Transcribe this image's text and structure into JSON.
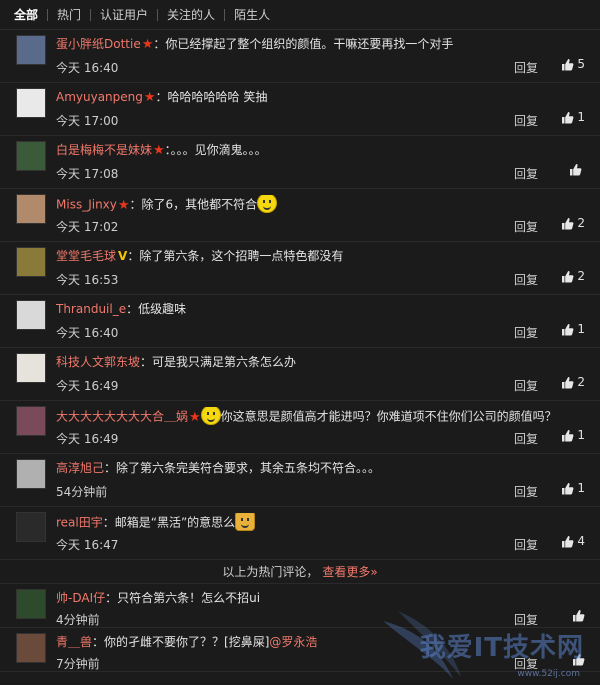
{
  "tabs": [
    "全部",
    "热门",
    "认证用户",
    "关注的人",
    "陌生人"
  ],
  "reply_label": "回复",
  "comments": [
    {
      "user": "蛋小胖纸Dottie",
      "badge": "star",
      "text": "：你已经撑起了整个组织的颜值。干嘛还要再找一个对手",
      "time": "今天 16:40",
      "likes": "5",
      "avatar": "#5a6a8a"
    },
    {
      "user": "Amyuyanpeng",
      "badge": "star",
      "text": "：哈哈哈哈哈哈 笑抽",
      "time": "今天 17:00",
      "likes": "1",
      "avatar": "#e9e9e9"
    },
    {
      "user": "白是梅梅不是妹妹",
      "badge": "star",
      "text": "：。。。见你滴鬼。。。",
      "time": "今天 17:08",
      "likes": "",
      "avatar": "#3a5a3a"
    },
    {
      "user": "Miss_Jinxy",
      "badge": "star",
      "text": "：除了6，其他都不符合",
      "emoji": "smile",
      "time": "今天 17:02",
      "likes": "2",
      "avatar": "#b08a6a"
    },
    {
      "user": "堂堂毛毛球",
      "badge": "v",
      "text": "：除了第六条，这个招聘一点特色都没有",
      "time": "今天 16:53",
      "likes": "2",
      "avatar": "#8a7a3a"
    },
    {
      "user": "Thranduil_e",
      "badge": "",
      "text": "：低级趣味",
      "time": "今天 16:40",
      "likes": "1",
      "avatar": "#d9d9d9"
    },
    {
      "user": "科技人文郭东坡",
      "badge": "",
      "text": "：可是我只满足第六条怎么办",
      "time": "今天 16:49",
      "likes": "2",
      "avatar": "#e6e2dc"
    },
    {
      "user": "大大大大大大大大合＿娲",
      "badge": "star",
      "text": "你这意思是颜值高才能进吗？你难道项不住你们公司的颜值吗？",
      "emoji": "laugh",
      "time": "今天 16:49",
      "likes": "1",
      "avatar": "#7a4a5a"
    },
    {
      "user": "高淳旭己",
      "badge": "",
      "text": "：除了第六条完美符合要求，其余五条均不符合。。。",
      "time": "54分钟前",
      "likes": "1",
      "avatar": "#b0b0b0"
    },
    {
      "user": "real田宇",
      "badge": "",
      "text": "：邮箱是“黑活”的意思么",
      "emoji": "cat",
      "time": "今天 16:47",
      "likes": "4",
      "avatar": "#2a2a2a"
    }
  ],
  "hot_note": {
    "text": "以上为热门评论，",
    "more": "查看更多»"
  },
  "recent": [
    {
      "user": "帅-DAI仔",
      "text": "：只符合第六条！怎么不招ui",
      "time": "4分钟前",
      "avatar": "#2d4a2d"
    },
    {
      "user": "青＿兽",
      "text": "：你的孑雌不要你了？？[挖鼻屎]",
      "mention": "@罗永浩",
      "time": "7分钟前",
      "avatar": "#6a4a3a"
    }
  ],
  "watermark": {
    "text": "我爱IT技术网",
    "url": "www.52ij.com"
  }
}
